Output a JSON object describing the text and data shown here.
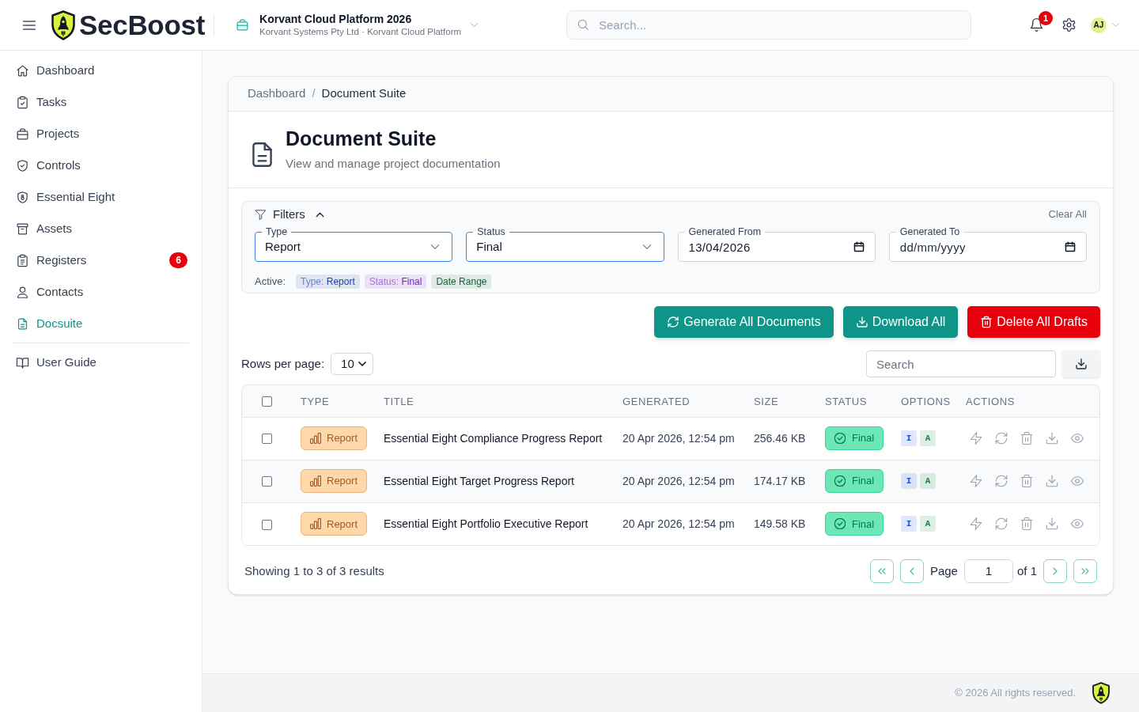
{
  "header": {
    "brand": "SecBoost",
    "project": {
      "name": "Korvant Cloud Platform 2026",
      "subtitle": "Korvant Systems Pty Ltd · Korvant Cloud Platform"
    },
    "search": {
      "placeholder": "Search..."
    },
    "notifications": {
      "count": "1"
    },
    "user": {
      "initials": "AJ"
    }
  },
  "sidebar": {
    "items": [
      {
        "label": "Dashboard",
        "selected": false
      },
      {
        "label": "Tasks",
        "selected": false
      },
      {
        "label": "Projects",
        "selected": false
      },
      {
        "label": "Controls",
        "selected": false
      },
      {
        "label": "Essential Eight",
        "selected": false
      },
      {
        "label": "Assets",
        "selected": false
      },
      {
        "label": "Registers",
        "selected": false,
        "badge": "6"
      },
      {
        "label": "Contacts",
        "selected": false
      },
      {
        "label": "Docsuite",
        "selected": true
      }
    ],
    "footer_items": [
      {
        "label": "User Guide",
        "selected": false
      }
    ]
  },
  "breadcrumb": {
    "items": [
      "Dashboard",
      "Document Suite"
    ],
    "separator": "/"
  },
  "page": {
    "title": "Document Suite",
    "subtitle": "View and manage project documentation"
  },
  "filters": {
    "title": "Filters",
    "expanded": true,
    "clear_label": "Clear All",
    "fields": [
      {
        "kind": "select",
        "label": "Type",
        "value": "Report",
        "highlighted": true
      },
      {
        "kind": "select",
        "label": "Status",
        "value": "Final",
        "highlighted": true
      },
      {
        "kind": "date",
        "label": "Generated From",
        "value": "13/04/2026",
        "highlighted": false
      },
      {
        "kind": "date",
        "label": "Generated To",
        "placeholder": "dd/mm/yyyy",
        "highlighted": false
      }
    ],
    "active_label": "Active:",
    "active_tags": [
      {
        "key": "Type:",
        "value": "Report",
        "color": "#1e40af"
      },
      {
        "key": "Status:",
        "value": "Final",
        "color": "#7e22ce"
      },
      {
        "value": "Date Range",
        "color": "#166534"
      }
    ]
  },
  "actions": [
    {
      "kind": "generate",
      "label": "Generate All Documents"
    },
    {
      "kind": "download",
      "label": "Download All"
    },
    {
      "kind": "delete",
      "label": "Delete All Drafts"
    }
  ],
  "table_toolbar": {
    "rows_per_page": {
      "label": "Rows per page:",
      "value": "10"
    },
    "search": {
      "placeholder": "Search"
    }
  },
  "table": {
    "select_all": {
      "checked": false
    },
    "columns": [
      "TYPE",
      "TITLE",
      "GENERATED",
      "SIZE",
      "STATUS",
      "OPTIONS",
      "ACTIONS"
    ],
    "rows": [
      {
        "checked": false,
        "type": "Report",
        "title": "Essential Eight Compliance Progress Report",
        "generated": "20 Apr 2026, 12:54 pm",
        "size": "256.46 KB",
        "status": "Final",
        "options": [
          {
            "label": "I",
            "color": "#1d4ed8"
          },
          {
            "label": "A",
            "color": "#15803d"
          }
        ]
      },
      {
        "checked": false,
        "type": "Report",
        "title": "Essential Eight Target Progress Report",
        "generated": "20 Apr 2026, 12:54 pm",
        "size": "174.17 KB",
        "status": "Final",
        "options": [
          {
            "label": "I",
            "color": "#1d4ed8"
          },
          {
            "label": "A",
            "color": "#15803d"
          }
        ]
      },
      {
        "checked": false,
        "type": "Report",
        "title": "Essential Eight Portfolio Executive Report",
        "generated": "20 Apr 2026, 12:54 pm",
        "size": "149.58 KB",
        "status": "Final",
        "options": [
          {
            "label": "I",
            "color": "#1d4ed8"
          },
          {
            "label": "A",
            "color": "#15803d"
          }
        ]
      }
    ]
  },
  "pagination": {
    "summary": "Showing 1 to 3 of 3 results",
    "page_label": "Page",
    "page": "1",
    "total_label": "of 1"
  },
  "footer": {
    "copyright": "© 2026 All rights reserved."
  }
}
